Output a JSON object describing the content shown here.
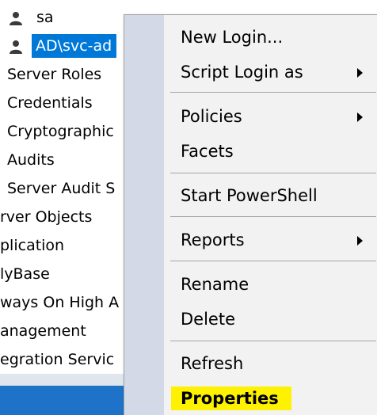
{
  "tree": {
    "items": [
      {
        "label": "sa",
        "icon": "user-icon"
      },
      {
        "label": "AD\\svc-ad",
        "icon": "user-icon",
        "selected": true
      },
      {
        "label": "Server Roles"
      },
      {
        "label": "Credentials"
      },
      {
        "label": "Cryptographic"
      },
      {
        "label": "Audits"
      },
      {
        "label": "Server Audit S"
      },
      {
        "label": "rver Objects"
      },
      {
        "label": "plication"
      },
      {
        "label": "lyBase"
      },
      {
        "label": "ways On High A"
      },
      {
        "label": "anagement"
      },
      {
        "label": "egration Servic"
      }
    ]
  },
  "context_menu": {
    "items": [
      {
        "label": "New Login..."
      },
      {
        "label": "Script Login as",
        "submenu": true
      },
      {
        "label": "Policies",
        "submenu": true
      },
      {
        "label": "Facets"
      },
      {
        "label": "Start PowerShell"
      },
      {
        "label": "Reports",
        "submenu": true
      },
      {
        "label": "Rename"
      },
      {
        "label": "Delete"
      },
      {
        "label": "Refresh"
      },
      {
        "label": "Properties",
        "highlighted": true
      }
    ]
  },
  "colors": {
    "selection": "#0078d7",
    "highlight": "#fff200",
    "menu_background": "#f2f2f2",
    "menu_gutter": "#d3d9e6"
  }
}
